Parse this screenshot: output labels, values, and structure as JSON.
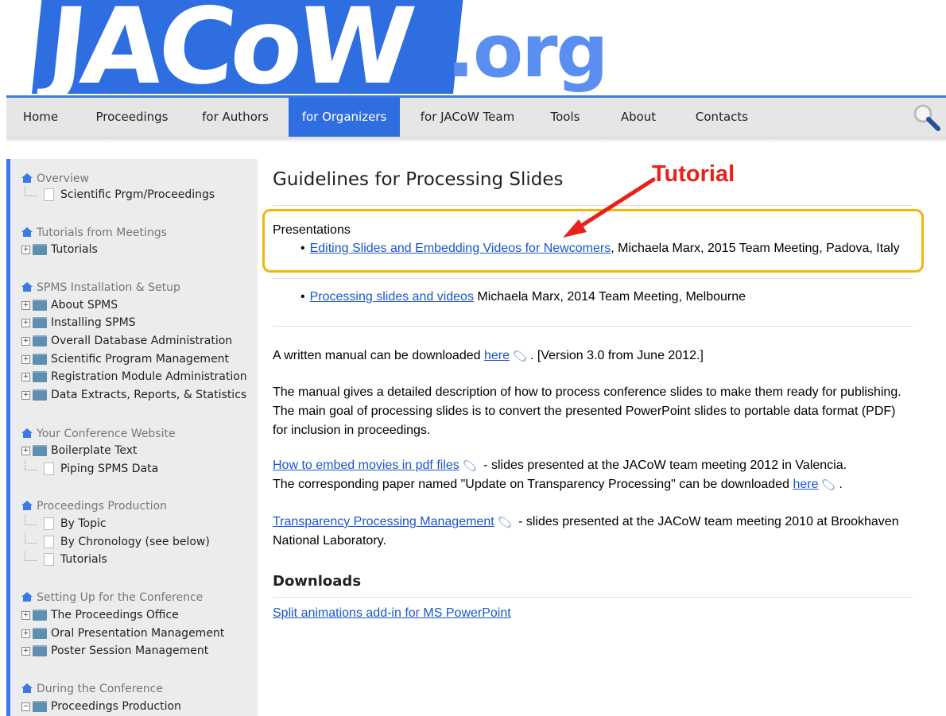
{
  "logo": {
    "main": "JACoW",
    "suffix": ".org"
  },
  "nav": {
    "items": [
      "Home",
      "Proceedings",
      "for Authors",
      "for Organizers",
      "for JACoW Team",
      "Tools",
      "About",
      "Contacts"
    ],
    "active": "for Organizers"
  },
  "sidebar": {
    "sections": [
      {
        "title": "Overview",
        "items": [
          {
            "label": "Scientific Prgm/Proceedings",
            "type": "leaf"
          }
        ]
      },
      {
        "title": "Tutorials from Meetings",
        "items": [
          {
            "label": "Tutorials",
            "type": "folder"
          }
        ]
      },
      {
        "title": "SPMS Installation & Setup",
        "items": [
          {
            "label": "About SPMS",
            "type": "folder"
          },
          {
            "label": "Installing SPMS",
            "type": "folder"
          },
          {
            "label": "Overall Database Administration",
            "type": "folder"
          },
          {
            "label": "Scientific Program Management",
            "type": "folder"
          },
          {
            "label": "Registration Module Administration",
            "type": "folder"
          },
          {
            "label": "Data Extracts, Reports, & Statistics",
            "type": "folder"
          }
        ]
      },
      {
        "title": "Your Conference Website",
        "items": [
          {
            "label": "Boilerplate Text",
            "type": "folder"
          },
          {
            "label": "Piping SPMS Data",
            "type": "leaf"
          }
        ]
      },
      {
        "title": "Proceedings Production",
        "items": [
          {
            "label": "By Topic",
            "type": "leaf"
          },
          {
            "label": "By Chronology (see below)",
            "type": "leaf"
          },
          {
            "label": "Tutorials",
            "type": "leaf"
          }
        ]
      },
      {
        "title": "Setting Up for the Conference",
        "items": [
          {
            "label": "The Proceedings Office",
            "type": "folder"
          },
          {
            "label": "Oral Presentation Management",
            "type": "folder"
          },
          {
            "label": "Poster Session Management",
            "type": "folder"
          }
        ]
      },
      {
        "title": "During the Conference",
        "items": [
          {
            "label": "Proceedings Production",
            "type": "folder"
          }
        ]
      }
    ]
  },
  "main": {
    "title": "Guidelines for Processing Slides",
    "presentations_label": "Presentations",
    "pres1_link": "Editing Slides and Embedding Videos for Newcomers",
    "pres1_rest": ", Michaela Marx, 2015 Team Meeting, Padova, Italy",
    "pres2_link": "Processing slides and videos",
    "pres2_rest": " Michaela Marx, 2014 Team Meeting, Melbourne",
    "manual_pre": "A written manual can be downloaded ",
    "manual_link": "here",
    "manual_post": ". [Version 3.0 from June 2012.]",
    "manual_desc": "The manual gives a detailed description of how to process conference slides to make them ready for publishing. The main goal of processing slides is to convert the presented PowerPoint slides to portable data format (PDF) for inclusion in proceedings.",
    "movies_link": "How to embed movies in pdf files",
    "movies_rest": " - slides presented at the JACoW team meeting 2012 in Valencia.",
    "paper_text": "The corresponding paper named \"Update on Transparency Processing\" can be downloaded ",
    "paper_link": "here",
    "paper_post": ".",
    "tpm_link": "Transparency Processing Management",
    "tpm_rest": " - slides presented at the JACoW team meeting 2010 at Brookhaven National Laboratory.",
    "downloads_title": "Downloads",
    "split_link": "Split animations add-in for MS PowerPoint"
  },
  "annotation": {
    "label": "Tutorial",
    "color": "#e8221a",
    "box_color": "#f2b50d"
  }
}
